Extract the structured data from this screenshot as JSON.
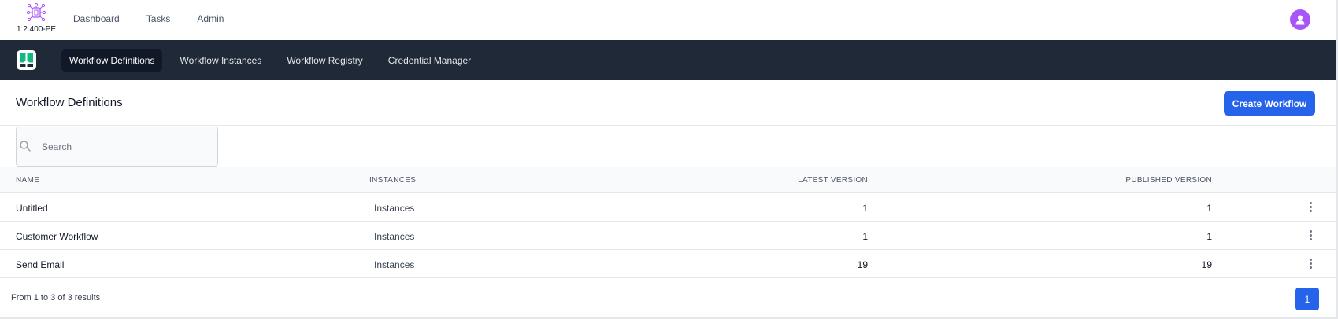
{
  "header": {
    "version": "1.2.400-PE",
    "nav": [
      "Dashboard",
      "Tasks",
      "Admin"
    ]
  },
  "appnav": {
    "tabs": [
      "Workflow Definitions",
      "Workflow Instances",
      "Workflow Registry",
      "Credential Manager"
    ],
    "active_tab": "Workflow Definitions"
  },
  "page": {
    "title": "Workflow Definitions",
    "create_label": "Create Workflow"
  },
  "search": {
    "placeholder": "Search",
    "value": ""
  },
  "table": {
    "columns": [
      "NAME",
      "INSTANCES",
      "LATEST VERSION",
      "PUBLISHED VERSION"
    ],
    "rows": [
      {
        "name": "Untitled",
        "instances": "Instances",
        "latest": "1",
        "published": "1"
      },
      {
        "name": "Customer Workflow",
        "instances": "Instances",
        "latest": "1",
        "published": "1"
      },
      {
        "name": "Send Email",
        "instances": "Instances",
        "latest": "19",
        "published": "19"
      }
    ]
  },
  "footer": {
    "results_prefix": "From ",
    "start": "1",
    "to": " to ",
    "end": "3",
    "of": " of ",
    "total": "3",
    "results_suffix": " results",
    "current_page": "1"
  },
  "colors": {
    "accent": "#2563eb",
    "nav_bg": "#1f2937",
    "avatar": "#a855f7",
    "logo": "#a855f7"
  }
}
